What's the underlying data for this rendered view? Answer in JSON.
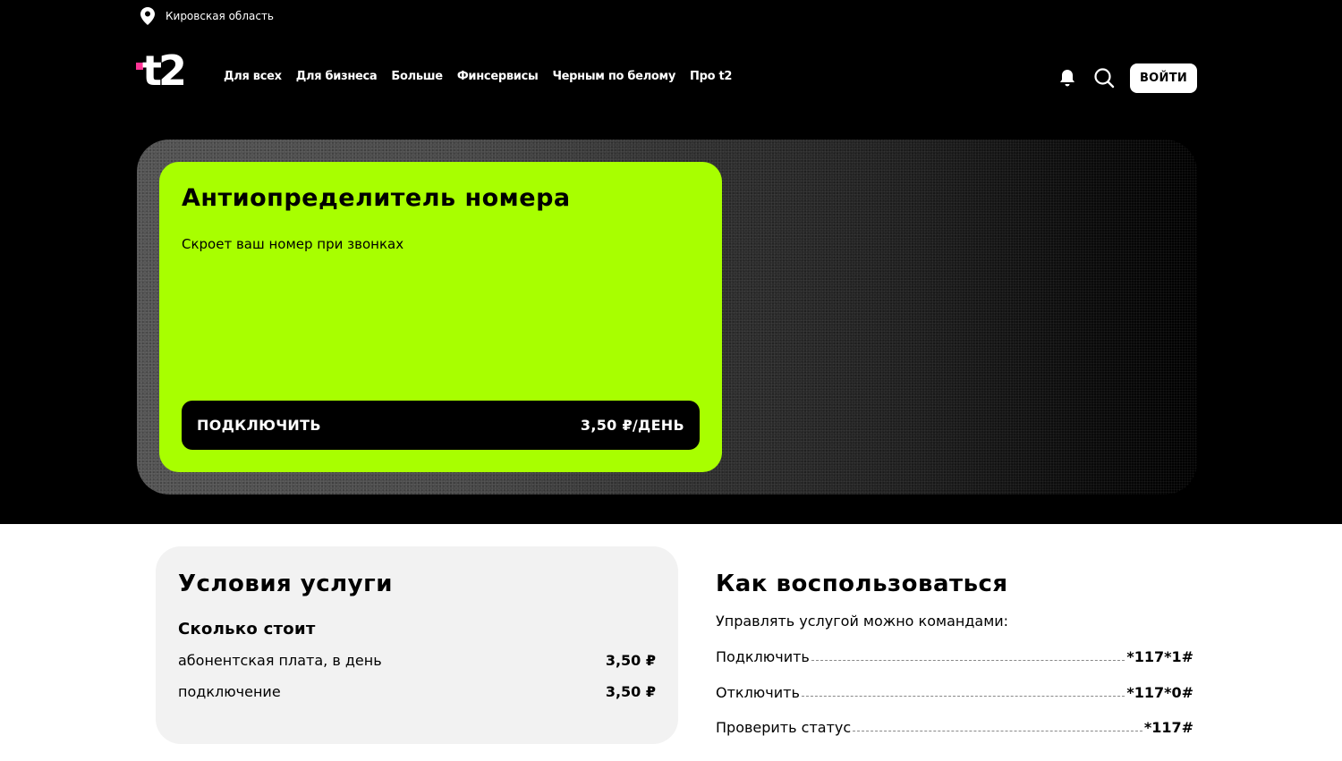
{
  "region": {
    "name": "Кировская область",
    "icon": "location-pin-icon"
  },
  "logo": {
    "text": "t2",
    "accent_color": "#ff3495"
  },
  "nav": [
    {
      "label": "Для всех"
    },
    {
      "label": "Для бизнеса"
    },
    {
      "label": "Больше"
    },
    {
      "label": "Финсервисы"
    },
    {
      "label": "Черным по белому"
    },
    {
      "label": "Про t2"
    }
  ],
  "header": {
    "login_label": "ВОЙТИ",
    "icons": [
      "bell-icon",
      "search-icon"
    ]
  },
  "hero": {
    "title": "Антиопределитель номера",
    "subtitle": "Скроет ваш номер при звонках",
    "cta_label": "ПОДКЛЮЧИТЬ",
    "cta_price": "3,50 ₽/ДЕНЬ",
    "card_color": "#a8ff00"
  },
  "conditions": {
    "title": "Условия услуги",
    "subtitle": "Сколько стоит",
    "rows": [
      {
        "label": "абонентская плата, в день",
        "value": "3,50 ₽"
      },
      {
        "label": "подключение",
        "value": "3,50 ₽"
      }
    ]
  },
  "how_to": {
    "title": "Как воспользоваться",
    "intro": "Управлять услугой можно командами:",
    "commands": [
      {
        "label": "Подключить",
        "code": "*117*1#"
      },
      {
        "label": "Отключить",
        "code": "*117*0#"
      },
      {
        "label": "Проверить статус",
        "code": "*117#"
      }
    ]
  }
}
